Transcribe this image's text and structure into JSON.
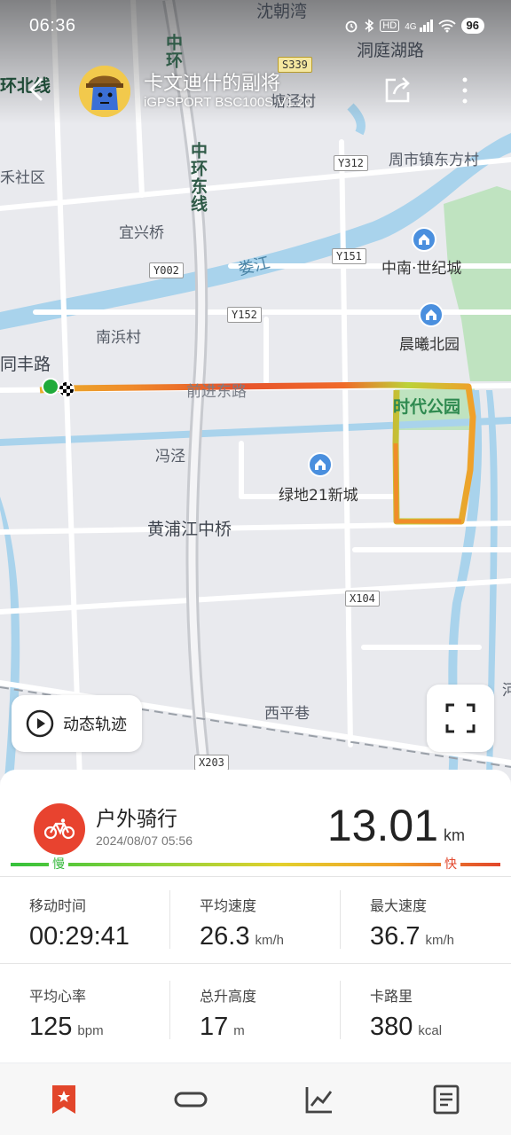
{
  "status_bar": {
    "time": "06:36",
    "icons": [
      "alarm-icon",
      "bluetooth-icon",
      "hd-icon",
      "signal-4g-icon",
      "wifi-icon"
    ],
    "network": "4G",
    "hd": "HD",
    "battery": "96"
  },
  "header": {
    "title": "卡文迪什的副将",
    "subtitle": "iGPSPORT BSC100S V1.20"
  },
  "map": {
    "labels": {
      "shenchaowan": "沈朝湾",
      "dongtinghu_road": "洞庭湖路",
      "huanbei_line": "环北线",
      "zhonghuan_top": "中环",
      "tangjing": "塘泾村",
      "hesheqv": "禾社区",
      "zhoushi_dongfang": "周市镇东方村",
      "zhonghuan_east": "中环东线",
      "yixingqiao": "宜兴桥",
      "loujiang": "娄江",
      "zhongnan_shiji": "中南·世纪城",
      "nanbincun": "南浜村",
      "chenxi_beiyuan": "晨曦北园",
      "tongfeng_road": "同丰路",
      "qianjin_east": "前进东路",
      "shidai_park": "时代公园",
      "fengjing": "冯泾",
      "lvdi21": "绿地21新城",
      "huangpujiang_bridge": "黄浦江中桥",
      "xipingxiang": "西平巷",
      "edge_right": "河"
    },
    "road_tags": {
      "s339": "S339",
      "y312": "Y312",
      "y151": "Y151",
      "y002": "Y002",
      "y152": "Y152",
      "x104": "X104",
      "x203": "X203"
    },
    "track_colors": {
      "slow": "#35c13b",
      "mid": "#f0a02a",
      "fast": "#e2462b"
    },
    "replay_label": "动态轨迹"
  },
  "activity": {
    "type": "户外骑行",
    "date": "2024/08/07 05:56",
    "distance": "13.01",
    "distance_unit": "km",
    "legend_slow": "慢",
    "legend_fast": "快",
    "accent_color": "#e8432f"
  },
  "stats": {
    "moving_time": {
      "label": "移动时间",
      "value": "00:29:41",
      "unit": ""
    },
    "avg_speed": {
      "label": "平均速度",
      "value": "26.3",
      "unit": "km/h"
    },
    "max_speed": {
      "label": "最大速度",
      "value": "36.7",
      "unit": "km/h"
    },
    "avg_hr": {
      "label": "平均心率",
      "value": "125",
      "unit": "bpm"
    },
    "elevation_gain": {
      "label": "总升高度",
      "value": "17",
      "unit": "m"
    },
    "calories": {
      "label": "卡路里",
      "value": "380",
      "unit": "kcal"
    }
  },
  "bottom_nav": {
    "items": [
      "bookmark-icon",
      "link-icon",
      "chart-icon",
      "document-icon"
    ],
    "active_color": "#e2462b"
  }
}
